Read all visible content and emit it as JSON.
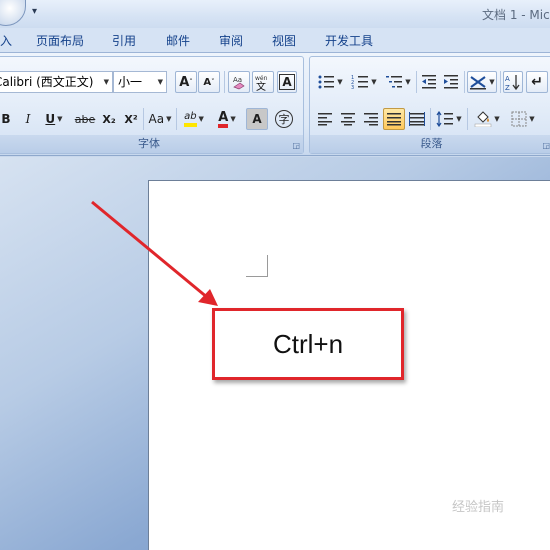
{
  "titlebar": {
    "title": "文档 1 - Mic",
    "qat_dropdown": "▾"
  },
  "tabs": [
    "入",
    "页面布局",
    "引用",
    "邮件",
    "审阅",
    "视图",
    "开发工具"
  ],
  "font_group": {
    "label": "字体",
    "font_name": "Calibri (西文正文)",
    "font_size": "小一",
    "grow_font": "A",
    "shrink_font": "A",
    "bold": "B",
    "italic": "I",
    "underline": "U",
    "strikethrough": "abe",
    "subscript": "X₂",
    "superscript": "X²",
    "change_case": "Aa",
    "highlight": "ab",
    "font_color": "A",
    "char_shading": "A",
    "enclose_char": "字"
  },
  "paragraph_group": {
    "label": "段落"
  },
  "document": {
    "callout_text": "Ctrl+n"
  },
  "watermark": "经验指南",
  "colors": {
    "accent_red": "#e0262b",
    "highlight_yellow": "#ffe600",
    "font_color_red": "#e0262b"
  }
}
